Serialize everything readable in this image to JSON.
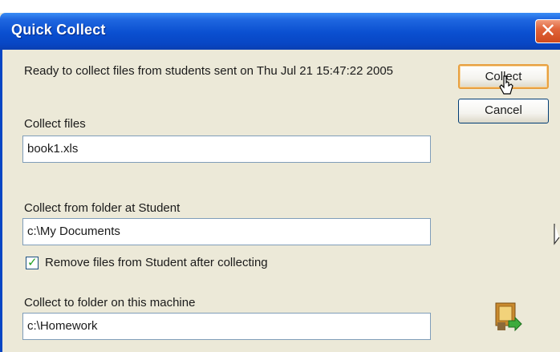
{
  "window": {
    "title": "Quick Collect",
    "close_glyph": "✕"
  },
  "status": {
    "message": "Ready to collect files from students sent on Thu Jul 21 15:47:22 2005"
  },
  "collect_files": {
    "label": "Collect files",
    "value": "book1.xls"
  },
  "student_folder": {
    "label": "Collect from folder at Student",
    "value": "c:\\My Documents"
  },
  "remove_option": {
    "label": "Remove files from Student after collecting",
    "checked": true
  },
  "local_folder": {
    "label": "Collect to folder on this machine",
    "value": "c:\\Homework"
  },
  "buttons": {
    "collect": "Collect",
    "cancel": "Cancel"
  },
  "icons": {
    "cursor": "mouse-pointer-icon",
    "app": "collect-files-icon"
  },
  "colors": {
    "titlebar": "#0a4fd0",
    "close": "#e0643a",
    "dialog_bg": "#ece9d8",
    "default_button_highlight": "#e8a040"
  }
}
